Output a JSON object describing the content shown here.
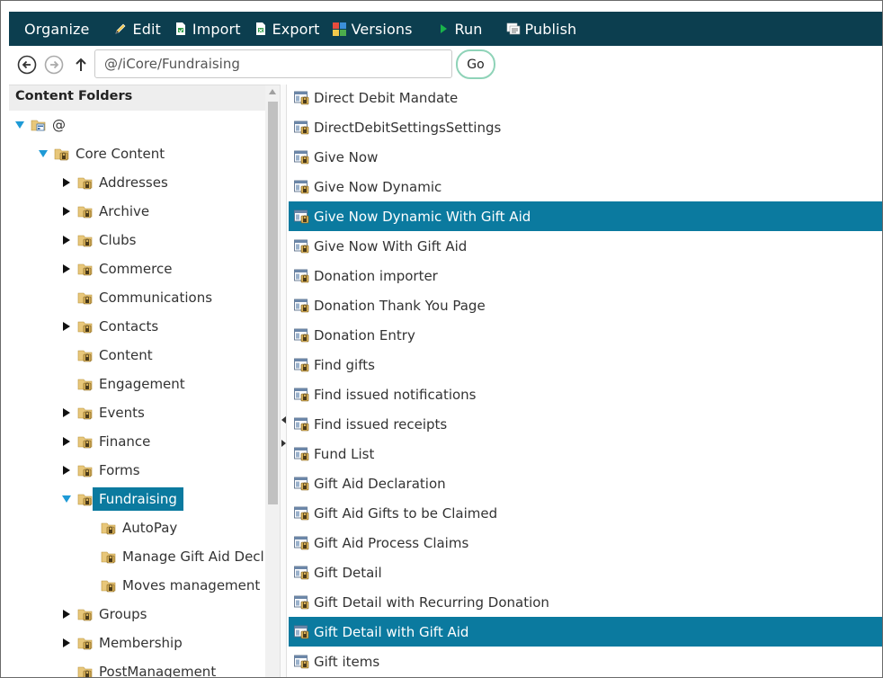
{
  "toolbar": {
    "items": [
      {
        "label": "Organize",
        "icon": "none"
      },
      {
        "label": "Edit",
        "icon": "pencil-icon"
      },
      {
        "label": "Import",
        "icon": "import-icon"
      },
      {
        "label": "Export",
        "icon": "export-icon"
      },
      {
        "label": "Versions",
        "icon": "versions-icon"
      },
      {
        "label": "Run",
        "icon": "play-icon"
      },
      {
        "label": "Publish",
        "icon": "publish-icon"
      }
    ]
  },
  "address": {
    "path": "@/iCore/Fundraising",
    "go_label": "Go"
  },
  "tree": {
    "header": "Content Folders",
    "nodes": [
      {
        "label": "@",
        "state": "open"
      },
      {
        "label": "Core Content",
        "state": "open"
      },
      {
        "label": "Addresses",
        "state": "closed"
      },
      {
        "label": "Archive",
        "state": "closed"
      },
      {
        "label": "Clubs",
        "state": "closed"
      },
      {
        "label": "Commerce",
        "state": "closed"
      },
      {
        "label": "Communications",
        "state": "leaf"
      },
      {
        "label": "Contacts",
        "state": "closed"
      },
      {
        "label": "Content",
        "state": "leaf"
      },
      {
        "label": "Engagement",
        "state": "leaf"
      },
      {
        "label": "Events",
        "state": "closed"
      },
      {
        "label": "Finance",
        "state": "closed"
      },
      {
        "label": "Forms",
        "state": "closed"
      },
      {
        "label": "Fundraising",
        "state": "open",
        "selected": true
      },
      {
        "label": "AutoPay",
        "state": "leaf"
      },
      {
        "label": "Manage Gift Aid Decl",
        "state": "leaf"
      },
      {
        "label": "Moves management",
        "state": "leaf"
      },
      {
        "label": "Groups",
        "state": "closed"
      },
      {
        "label": "Membership",
        "state": "closed"
      },
      {
        "label": "PostManagement",
        "state": "leaf"
      }
    ]
  },
  "list": {
    "items": [
      {
        "label": "Direct Debit Mandate"
      },
      {
        "label": "DirectDebitSettingsSettings"
      },
      {
        "label": "Give Now"
      },
      {
        "label": "Give Now Dynamic"
      },
      {
        "label": "Give Now Dynamic With Gift Aid",
        "selected": true
      },
      {
        "label": "Give Now With Gift Aid"
      },
      {
        "label": "Donation importer"
      },
      {
        "label": "Donation Thank You Page"
      },
      {
        "label": "Donation Entry"
      },
      {
        "label": "Find gifts"
      },
      {
        "label": "Find issued notifications"
      },
      {
        "label": "Find issued receipts"
      },
      {
        "label": "Fund List"
      },
      {
        "label": "Gift Aid Declaration"
      },
      {
        "label": "Gift Aid Gifts to be Claimed"
      },
      {
        "label": "Gift Aid Process Claims"
      },
      {
        "label": "Gift Detail"
      },
      {
        "label": "Gift Detail with Recurring Donation"
      },
      {
        "label": "Gift Detail with Gift Aid",
        "selected": true
      },
      {
        "label": "Gift items"
      }
    ]
  },
  "colors": {
    "toolbar_bg": "#0c3e4f",
    "selection": "#0b7a9f",
    "go_border": "#8fd3b8",
    "expand_arrow": "#1e9ad6"
  }
}
